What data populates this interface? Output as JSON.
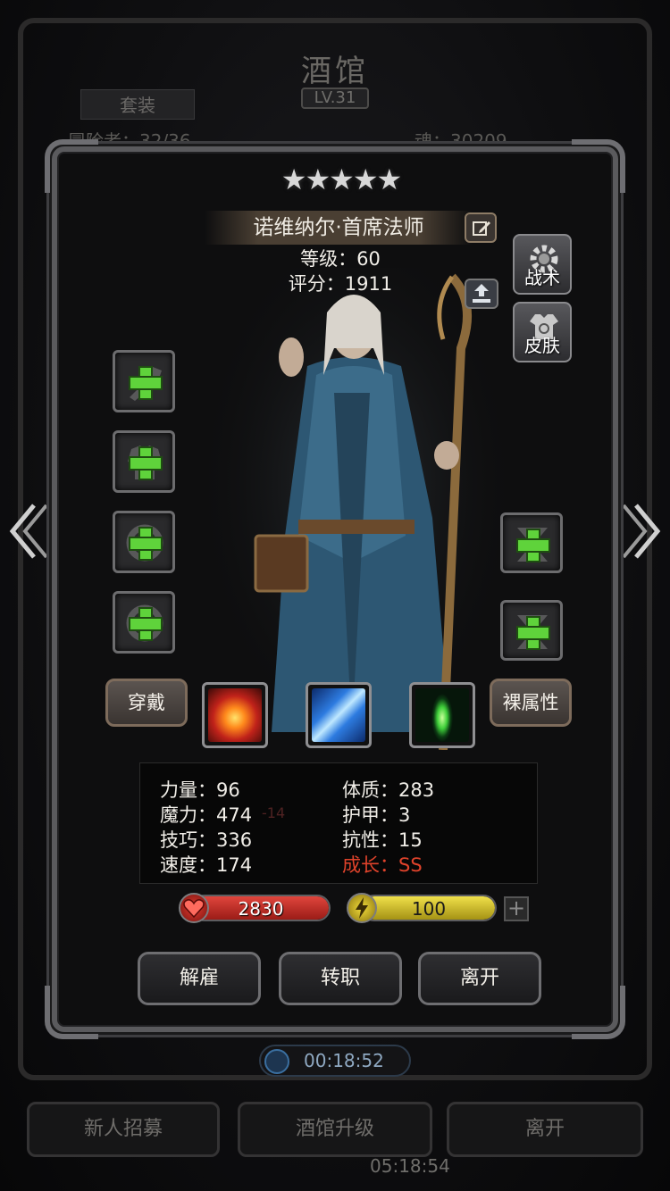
{
  "background": {
    "title": "酒馆",
    "level": "LV.31",
    "set_button": "套装",
    "adventurers": "冒险者：32/36",
    "soul": "魂：30209",
    "timer": "00:18:52",
    "bottom_buttons": [
      "新人招募",
      "酒馆升级",
      "离开"
    ],
    "bottom_time": "05:18:54"
  },
  "hero": {
    "stars": "★★★★★",
    "star_count": 5,
    "name": "诺维纳尔·首席法师",
    "level_line": "等级：60",
    "score_line": "评分：1911"
  },
  "side_buttons": {
    "tactics": "战术",
    "skin": "皮肤"
  },
  "buttons": {
    "wear": "穿戴",
    "naked_attr": "裸属性",
    "dismiss": "解雇",
    "transfer": "转职",
    "leave": "离开"
  },
  "attributes": {
    "strength": "力量：96",
    "magic": "魔力：474",
    "magic_bonus": "-14",
    "skill": "技巧：336",
    "speed": "速度：174",
    "constitution": "体质：283",
    "armor": "护甲：3",
    "resistance": "抗性：15",
    "growth": "成长：SS"
  },
  "bars": {
    "hp": "2830",
    "energy": "100",
    "energy_plus": "+"
  },
  "colors": {
    "growth": "#e0432b",
    "hp_fill": "#c42a24",
    "energy_fill": "#d9c62a",
    "plus_green": "#5fd33b"
  },
  "icons": [
    "edit-icon",
    "share-icon",
    "gear-icon",
    "skin-icon",
    "plus-icon",
    "chevron-left-icon",
    "chevron-right-icon",
    "heart-icon",
    "lightning-icon",
    "fire-skill-icon",
    "ice-skill-icon",
    "nature-skill-icon"
  ]
}
